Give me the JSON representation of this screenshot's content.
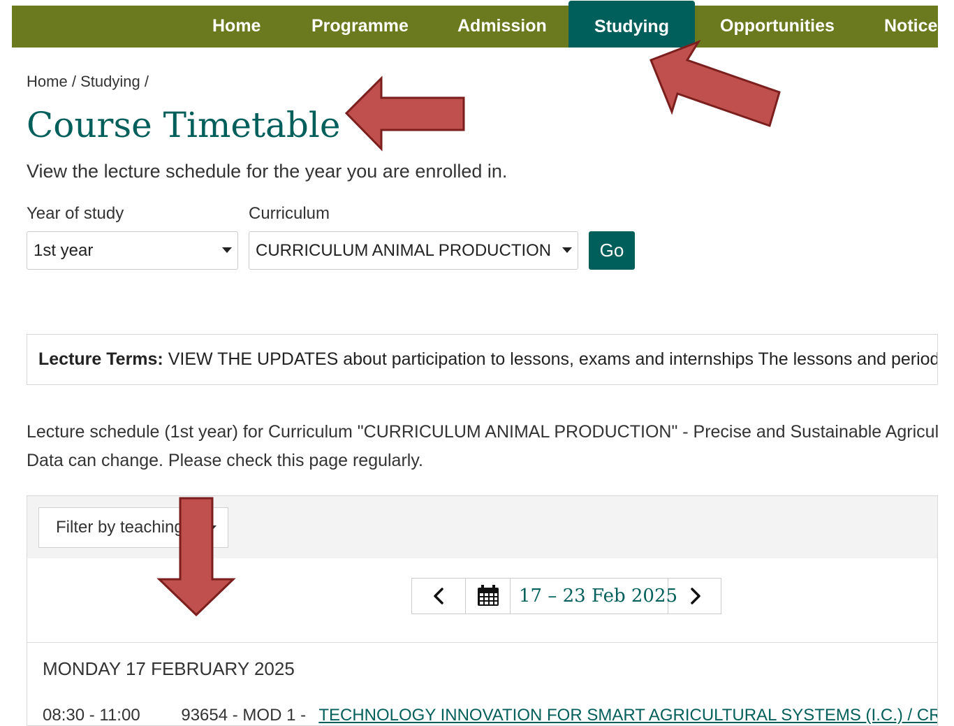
{
  "nav": {
    "items": [
      {
        "label": "Home"
      },
      {
        "label": "Programme"
      },
      {
        "label": "Admission"
      },
      {
        "label": "Studying"
      },
      {
        "label": "Opportunities"
      },
      {
        "label": "Notice"
      }
    ],
    "active": "Studying"
  },
  "breadcrumb": {
    "home": "Home",
    "sep": "/",
    "studying": "Studying"
  },
  "page": {
    "title": "Course Timetable",
    "subtitle": "View the lecture schedule for the year you are enrolled in."
  },
  "filters": {
    "year_label": "Year of study",
    "year_value": "1st year",
    "curriculum_label": "Curriculum",
    "curriculum_value": "CURRICULUM ANIMAL PRODUCTION",
    "go_label": "Go"
  },
  "lecture_terms": {
    "label": "Lecture Terms:",
    "text": "VIEW THE UPDATES about participation to lessons, exams and internships The lessons and periods"
  },
  "schedule": {
    "line1": "Lecture schedule (1st year) for Curriculum \"CURRICULUM ANIMAL PRODUCTION\" - Precise and Sustainable Agriculture",
    "line2": "Data can change. Please check this page regularly."
  },
  "calendar": {
    "filter_label": "Filter by teaching",
    "date_range": "17 – 23 Feb 2025",
    "day_heading": "MONDAY 17 FEBRUARY 2025",
    "events": [
      {
        "time": "08:30 - 11:00",
        "code": "93654 - MOD 1 -",
        "title": "TECHNOLOGY INNOVATION FOR SMART AGRICULTURAL SYSTEMS (I.C.) / CROP SENSING"
      }
    ]
  },
  "colors": {
    "nav_bg": "#6b7a1f",
    "accent": "#005f5a",
    "annotation_arrow": "#c0504d"
  },
  "icons": {
    "prev": "chevron-left-icon",
    "calendar": "calendar-icon",
    "next": "chevron-right-icon"
  }
}
